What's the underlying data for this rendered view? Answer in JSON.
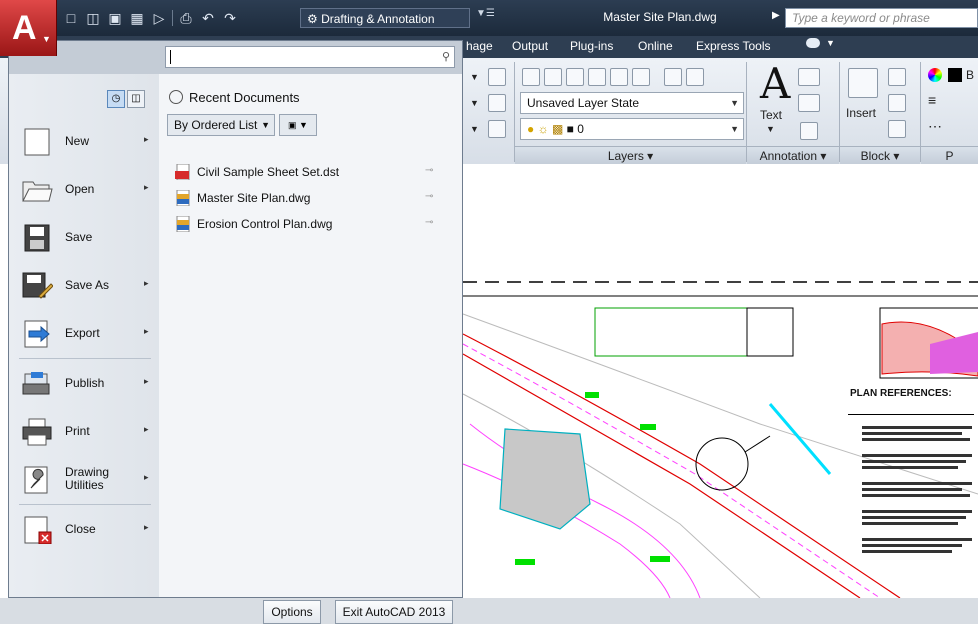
{
  "window": {
    "doc_title": "Master Site Plan.dwg",
    "search_placeholder": "Type a keyword or phrase"
  },
  "qat": {
    "workspace": "Drafting & Annotation",
    "icons": [
      "new-icon",
      "open-icon",
      "save-icon",
      "save-as-icon",
      "plot-icon",
      "print-icon",
      "undo-icon",
      "redo-icon"
    ]
  },
  "ribbon": {
    "tabs": [
      "hage",
      "Output",
      "Plug-ins",
      "Online",
      "Express Tools"
    ],
    "layer_state": "Unsaved Layer State",
    "layer_current": "0",
    "panels": {
      "layers": "Layers ▾",
      "annotation": "Annotation ▾",
      "block": "Block ▾",
      "properties": "P"
    },
    "text_label": "Text",
    "insert_label": "Insert",
    "prop_label": "B"
  },
  "app_menu": {
    "search_value": "",
    "items": [
      {
        "label": "New",
        "arrow": "▸"
      },
      {
        "label": "Open",
        "arrow": "▸"
      },
      {
        "label": "Save",
        "arrow": ""
      },
      {
        "label": "Save As",
        "arrow": "▸"
      },
      {
        "label": "Export",
        "arrow": "▸"
      },
      {
        "label": "Publish",
        "arrow": "▸"
      },
      {
        "label": "Print",
        "arrow": "▸"
      },
      {
        "label": "Drawing Utilities",
        "arrow": "▸"
      },
      {
        "label": "Close",
        "arrow": "▸"
      }
    ],
    "recent_title": "Recent Documents",
    "order_by": "By Ordered List",
    "documents": [
      {
        "name": "Civil Sample Sheet Set.dst",
        "icon": "dst-file-icon"
      },
      {
        "name": "Master Site Plan.dwg",
        "icon": "dwg-file-icon"
      },
      {
        "name": "Erosion Control Plan.dwg",
        "icon": "dwg-file-icon"
      }
    ],
    "options_label": "Options",
    "exit_label": "Exit AutoCAD 2013"
  },
  "drawing": {
    "plan_references": "PLAN REFERENCES:"
  },
  "colors": {
    "app_button": "#c0282b",
    "title_bar": "#24344a",
    "menu_bg": "#f3f5f8"
  }
}
